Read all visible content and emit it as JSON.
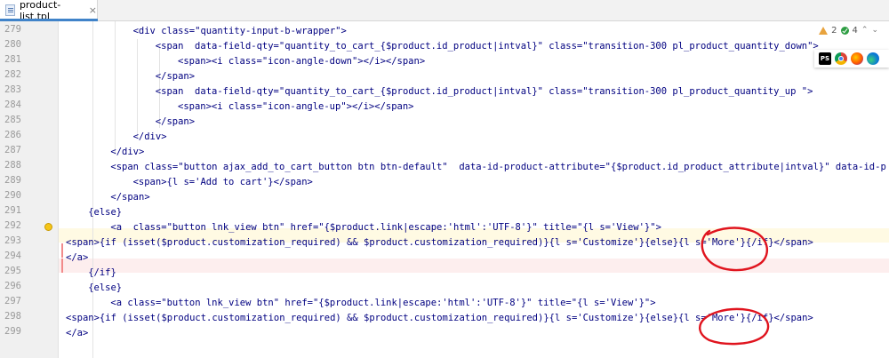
{
  "tab": {
    "file_name": "product-list.tpl",
    "close_symbol": "×"
  },
  "inspection": {
    "warnings": "2",
    "ok_count": "4",
    "chevron_up": "⌃",
    "chevron_down": "⌄"
  },
  "browsers": [
    "PS",
    "Chrome",
    "Firefox",
    "Edge"
  ],
  "lines": [
    {
      "num": "279",
      "text": "<div class=\"quantity-input-b-wrapper\">"
    },
    {
      "num": "280",
      "text": "<span  data-field-qty=\"quantity_to_cart_{$product.id_product|intval}\" class=\"transition-300 pl_product_quantity_down\">"
    },
    {
      "num": "281",
      "text": "<span><i class=\"icon-angle-down\"></i></span>"
    },
    {
      "num": "282",
      "text": "</span>"
    },
    {
      "num": "283",
      "text": "<span  data-field-qty=\"quantity_to_cart_{$product.id_product|intval}\" class=\"transition-300 pl_product_quantity_up \">"
    },
    {
      "num": "284",
      "text": "<span><i class=\"icon-angle-up\"></i></span>"
    },
    {
      "num": "285",
      "text": "</span>"
    },
    {
      "num": "286",
      "text": "</div>"
    },
    {
      "num": "287",
      "text": "</div>"
    },
    {
      "num": "288",
      "text": "<span class=\"button ajax_add_to_cart_button btn btn-default\"  data-id-product-attribute=\"{$product.id_product_attribute|intval}\" data-id-p"
    },
    {
      "num": "289",
      "text": "<span>{l s='Add to cart'}</span>"
    },
    {
      "num": "290",
      "text": "</span>"
    },
    {
      "num": "291",
      "text": "{else}"
    },
    {
      "num": "292",
      "text": "<a  class=\"button lnk_view btn\" href=\"{$product.link|escape:'html':'UTF-8'}\" title=\"{l s='View'}\">"
    },
    {
      "num": "293",
      "text": "<span>{if (isset($product.customization_required) && $product.customization_required)}{l s='Customize'}{else}{l s='More'}{/if}</span>"
    },
    {
      "num": "294",
      "text": "</a>"
    },
    {
      "num": "295",
      "text": "{/if}"
    },
    {
      "num": "296",
      "text": "{else}"
    },
    {
      "num": "297",
      "text": "<a class=\"button lnk_view btn\" href=\"{$product.link|escape:'html':'UTF-8'}\" title=\"{l s='View'}\">"
    },
    {
      "num": "298",
      "text": "<span>{if (isset($product.customization_required) && $product.customization_required)}{l s='Customize'}{else}{l s='More'}{/if}</span>"
    },
    {
      "num": "299",
      "text": "</a>"
    }
  ],
  "colors": {
    "annotation_red": "#e0141e",
    "current_line": "#fffae3",
    "error_line": "#fdeeee"
  }
}
